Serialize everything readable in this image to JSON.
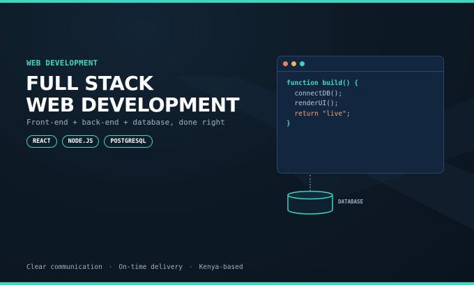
{
  "eyebrow": "WEB DEVELOPMENT",
  "title": {
    "line1": "FULL STACK",
    "line2": "WEB DEVELOPMENT"
  },
  "subtitle": "Front-end + back-end + database, done right",
  "tags": [
    "REACT",
    "NODE.JS",
    "POSTGRESQL"
  ],
  "code_window": {
    "dots": [
      "#e8866a",
      "#f2b45c",
      "#3fd6bf"
    ],
    "lines": {
      "l1": "function build() {",
      "l2": "  connectDB();",
      "l3": "  renderUI();",
      "l4a": "  return ",
      "l4b": "\"live\"",
      "l4c": ";",
      "l5": "}"
    }
  },
  "database_label": "DATABASE",
  "footer": {
    "items": [
      "Clear communication",
      "On-time delivery",
      "Kenya-based"
    ],
    "separator": "·"
  },
  "colors": {
    "accent": "#3fd6bf",
    "background": "#0d1a26",
    "text_muted": "#9fb1c0",
    "string": "#f2a46e"
  }
}
